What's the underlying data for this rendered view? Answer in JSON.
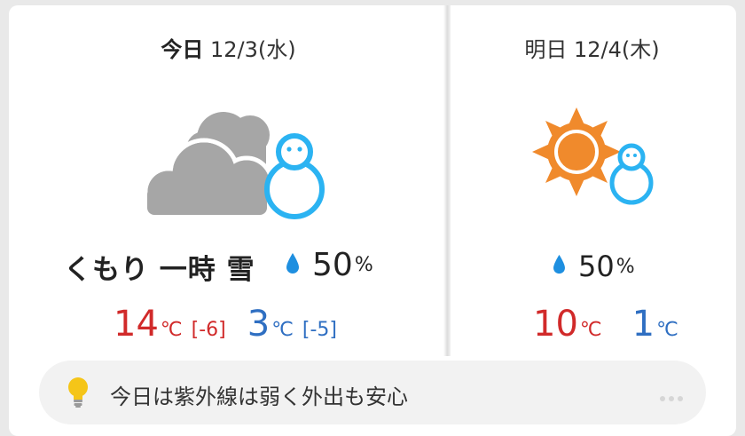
{
  "today": {
    "day_word": "今日",
    "date": "12/3",
    "weekday": "(水)",
    "icon": "cloudy-with-snow-icon",
    "condition": "くもり 一時 雪",
    "rain_chance": "50",
    "rain_unit": "%",
    "high": "14",
    "high_diff": "[-6]",
    "low": "3",
    "low_diff": "[-5]",
    "temp_unit": "℃"
  },
  "tomorrow": {
    "day_word": "明日",
    "date": "12/4",
    "weekday": "(木)",
    "icon": "sunny-with-snow-icon",
    "rain_chance": "50",
    "rain_unit": "%",
    "high": "10",
    "low": "1",
    "temp_unit": "℃"
  },
  "advice": {
    "icon": "lightbulb-icon",
    "text": "今日は紫外線は弱く外出も安心"
  },
  "colors": {
    "high": "#d12a2a",
    "low": "#2f6fc2",
    "rain_drop": "#1e8fe0",
    "cloud": "#a6a6a6",
    "snowman": "#2bb3f2",
    "sun": "#f08a2c"
  }
}
